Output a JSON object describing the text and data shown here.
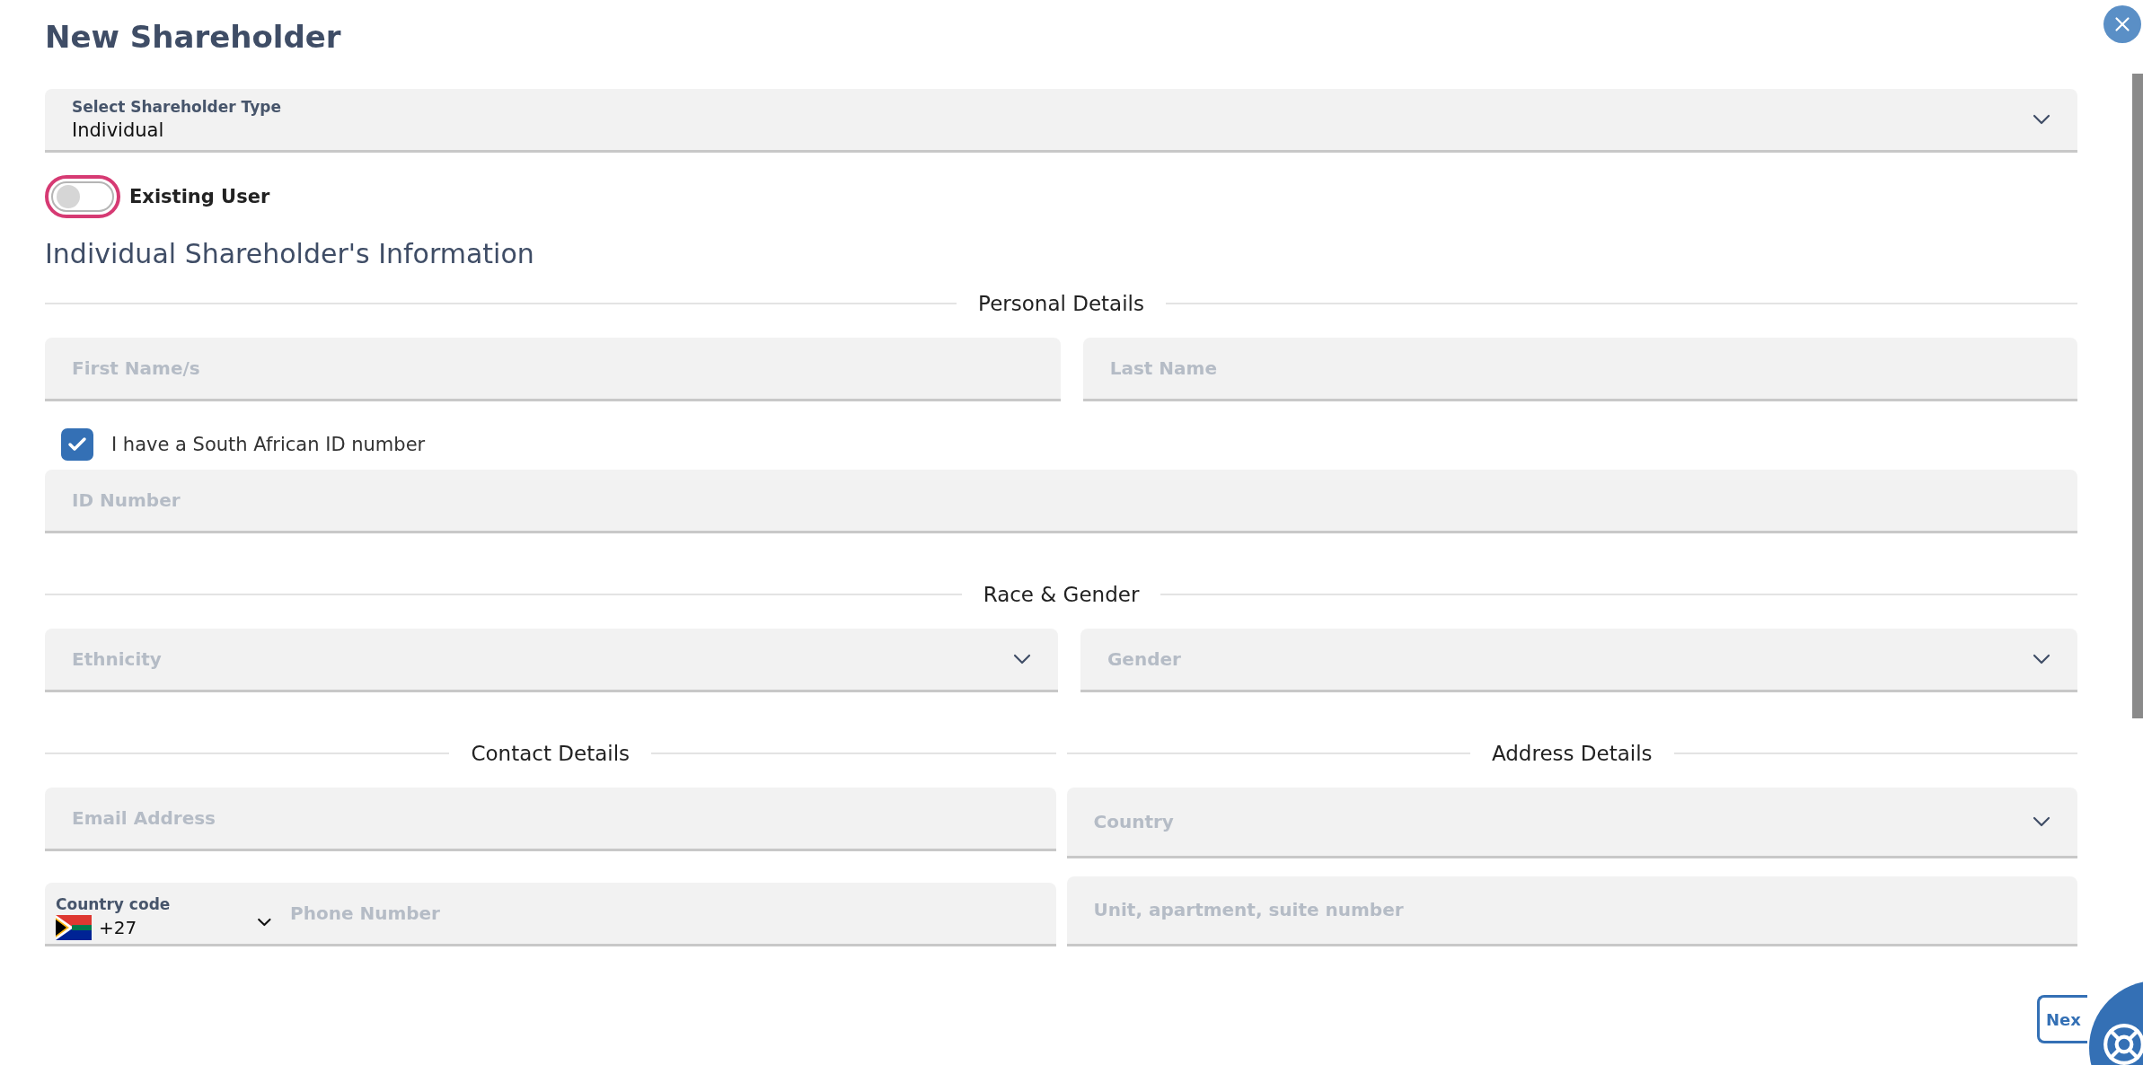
{
  "title": "New Shareholder",
  "shareholder_type": {
    "label": "Select Shareholder Type",
    "value": "Individual"
  },
  "existing_user": {
    "label": "Existing User",
    "on": false
  },
  "section_title": "Individual Shareholder's Information",
  "blocks": [
    {
      "kind": "divider",
      "label": "Personal Details"
    },
    {
      "kind": "fields",
      "fields": [
        {
          "kind": "text",
          "placeholder": "First Name/s"
        },
        {
          "kind": "text",
          "placeholder": "Last Name"
        }
      ]
    },
    {
      "kind": "checkbox",
      "label": "I have a South African ID number",
      "checked": true
    },
    {
      "kind": "fields",
      "fields": [
        {
          "kind": "text",
          "placeholder": "ID Number"
        }
      ]
    },
    {
      "kind": "divider",
      "label": "Race & Gender"
    },
    {
      "kind": "fields",
      "fields": [
        {
          "kind": "select",
          "placeholder": "Ethnicity"
        },
        {
          "kind": "select",
          "placeholder": "Gender"
        }
      ]
    }
  ],
  "columns": [
    {
      "heading": "Contact Details",
      "fields": [
        {
          "kind": "text",
          "placeholder": "Email Address"
        },
        {
          "kind": "phone",
          "code_label": "Country code",
          "code": "+27",
          "placeholder": "Phone Number"
        }
      ]
    },
    {
      "heading": "Address Details",
      "fields": [
        {
          "kind": "select",
          "placeholder": "Country"
        },
        {
          "kind": "text",
          "placeholder": "Unit, apartment, suite number"
        }
      ]
    }
  ],
  "next_button": {
    "label": "Nex"
  }
}
